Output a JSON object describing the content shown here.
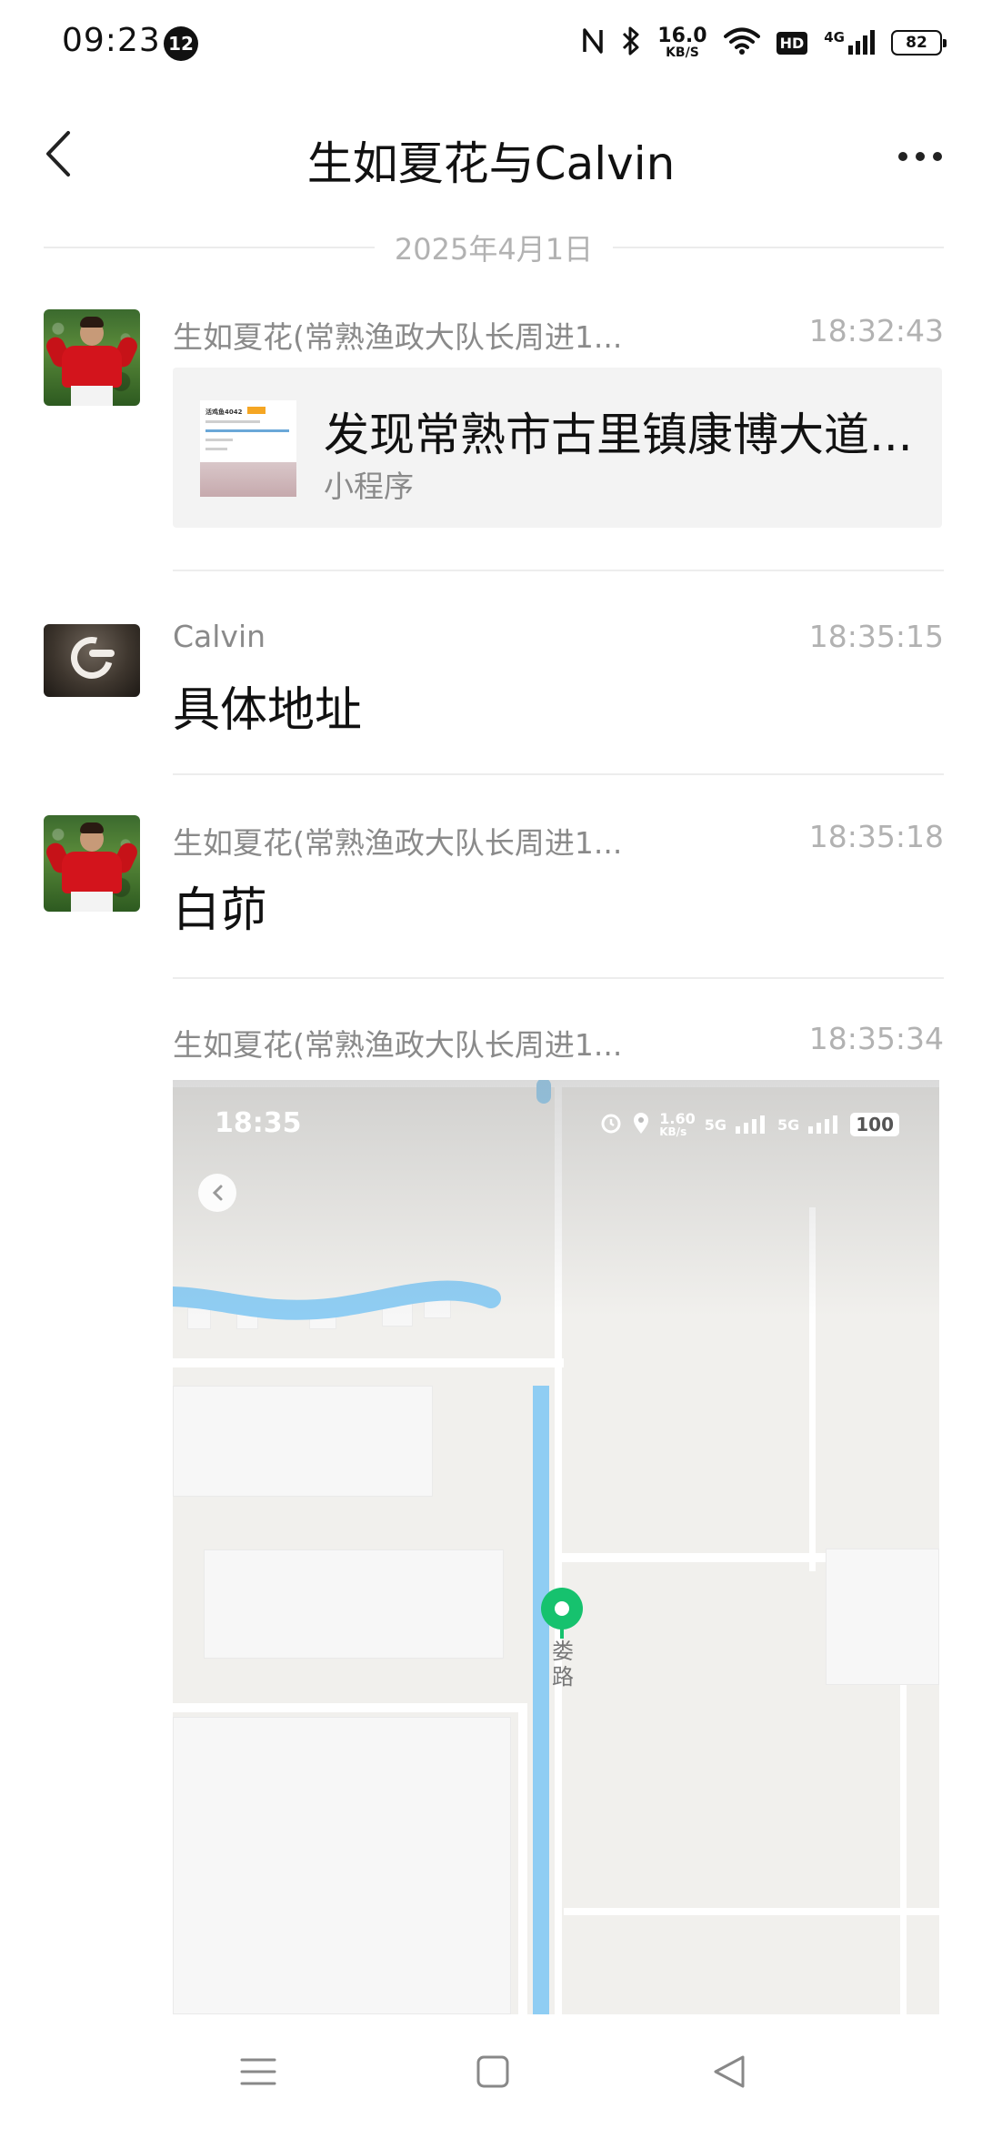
{
  "status_bar": {
    "time": "09:23",
    "notification_count": "12",
    "net_speed_value": "16.0",
    "net_speed_unit": "KB/S",
    "hd_label": "HD",
    "network_type": "4G",
    "battery": "82"
  },
  "header": {
    "title": "生如夏花与Calvin"
  },
  "date_separator": "2025年4月1日",
  "messages": [
    {
      "sender": "生如夏花(常熟渔政大队长周进1...",
      "time": "18:32:43",
      "type": "mini_program",
      "card": {
        "title": "发现常熟市古里镇康博大道...",
        "subtitle": "小程序",
        "thumb_text": "活鸡鱼4042"
      }
    },
    {
      "sender": "Calvin",
      "time": "18:35:15",
      "type": "text",
      "text": "具体地址"
    },
    {
      "sender": "生如夏花(常熟渔政大队长周进1...",
      "time": "18:35:18",
      "type": "text",
      "text": "白茆"
    },
    {
      "sender": "生如夏花(常熟渔政大队长周进1...",
      "time": "18:35:34",
      "type": "image",
      "image": {
        "inner_time": "18:35",
        "inner_net_speed": "1.60",
        "inner_net_unit": "KB/s",
        "inner_signal_1": "5G",
        "inner_signal_2": "5G",
        "inner_battery": "100",
        "road_label": "娄路"
      }
    }
  ],
  "colors": {
    "accent_green": "#16c26e",
    "river_blue": "#8fcdf3",
    "card_bg": "#f3f3f3"
  },
  "icons": {
    "back": "chevron-left-icon",
    "more": "more-dots-icon",
    "nav_menu": "menu-icon",
    "nav_home": "home-square-icon",
    "nav_back": "back-triangle-icon"
  }
}
